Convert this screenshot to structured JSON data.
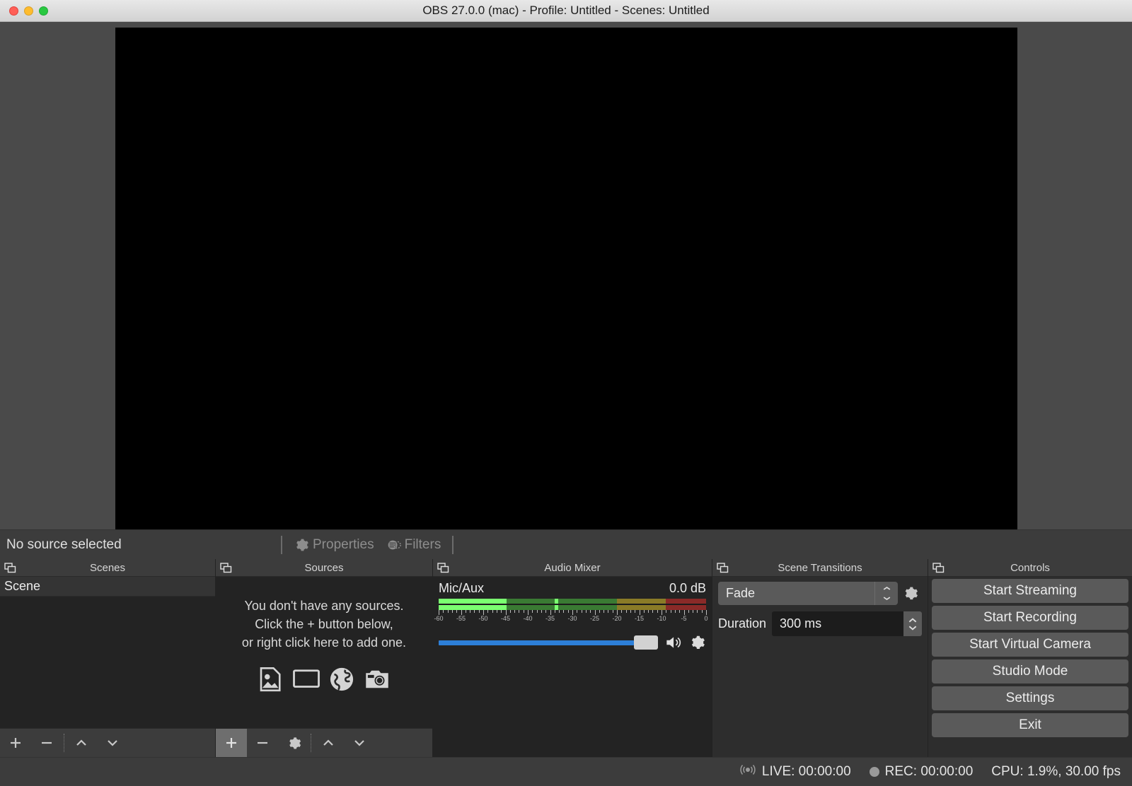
{
  "window": {
    "title": "OBS 27.0.0 (mac) - Profile: Untitled - Scenes: Untitled",
    "traffic_lights": [
      "close",
      "minimize",
      "zoom"
    ]
  },
  "preview": {
    "canvas_color": "#000000",
    "background_color": "#4a4a4a"
  },
  "source_toolbar": {
    "status_label": "No source selected",
    "properties_label": "Properties",
    "filters_label": "Filters",
    "properties_icon": "gear-icon",
    "filters_icon": "filters-icon",
    "disabled_color": "#8d8d8d"
  },
  "docks": {
    "scenes": {
      "title": "Scenes",
      "float_icon": "undock-icon",
      "items": [
        {
          "label": "Scene",
          "selected": true
        }
      ],
      "toolbar": [
        {
          "name": "add-scene-button",
          "icon": "plus-icon",
          "highlighted": false
        },
        {
          "name": "remove-scene-button",
          "icon": "minus-icon",
          "highlighted": false
        },
        {
          "name": "move-scene-up-button",
          "icon": "chevron-up-icon",
          "highlighted": false
        },
        {
          "name": "move-scene-down-button",
          "icon": "chevron-down-icon",
          "highlighted": false
        }
      ]
    },
    "sources": {
      "title": "Sources",
      "float_icon": "undock-icon",
      "empty_lines": [
        "You don't have any sources.",
        "Click the + button below,",
        "or right click here to add one."
      ],
      "empty_icons": [
        "image-icon",
        "display-icon",
        "browser-icon",
        "camera-icon"
      ],
      "toolbar": [
        {
          "name": "add-source-button",
          "icon": "plus-icon",
          "highlighted": true
        },
        {
          "name": "remove-source-button",
          "icon": "minus-icon",
          "highlighted": false
        },
        {
          "name": "source-properties-button",
          "icon": "gear-icon",
          "highlighted": false
        },
        {
          "name": "move-source-up-button",
          "icon": "chevron-up-icon",
          "highlighted": false
        },
        {
          "name": "move-source-down-button",
          "icon": "chevron-down-icon",
          "highlighted": false
        }
      ]
    },
    "mixer": {
      "title": "Audio Mixer",
      "float_icon": "undock-icon",
      "channel_name": "Mic/Aux",
      "db_value": "0.0 dB",
      "meter": {
        "min_db": -60,
        "max_db": 0,
        "tick_labels": [
          "-60",
          "-55",
          "-50",
          "-45",
          "-40",
          "-35",
          "-30",
          "-25",
          "-20",
          "-15",
          "-10",
          "-5",
          "0"
        ],
        "level_db": -45,
        "peak_db": -34,
        "green_end_db": -20,
        "yellow_end_db": -9,
        "colors": {
          "lit": "#7bff70",
          "green_bg": "#3a7a33",
          "yellow_bg": "#8a7b27",
          "red_bg": "#8a2a28"
        }
      },
      "volume_percent": 100,
      "slider_color": "#2d7fd8",
      "mute_icon": "speaker-icon",
      "settings_icon": "gear-icon"
    },
    "transitions": {
      "title": "Scene Transitions",
      "float_icon": "undock-icon",
      "transition_value": "Fade",
      "transition_options": [
        "Fade"
      ],
      "properties_icon": "gear-icon",
      "duration_label": "Duration",
      "duration_value": "300 ms"
    },
    "controls": {
      "title": "Controls",
      "float_icon": "undock-icon",
      "buttons": [
        {
          "label": "Start Streaming",
          "name": "start-streaming-button"
        },
        {
          "label": "Start Recording",
          "name": "start-recording-button"
        },
        {
          "label": "Start Virtual Camera",
          "name": "start-virtual-camera-button"
        },
        {
          "label": "Studio Mode",
          "name": "studio-mode-button"
        },
        {
          "label": "Settings",
          "name": "settings-button"
        },
        {
          "label": "Exit",
          "name": "exit-button"
        }
      ]
    }
  },
  "statusbar": {
    "live_icon": "broadcast-icon",
    "live_label": "LIVE: 00:00:00",
    "rec_icon": "record-dot-icon",
    "rec_label": "REC: 00:00:00",
    "cpu_label": "CPU: 1.9%, 30.00 fps"
  }
}
